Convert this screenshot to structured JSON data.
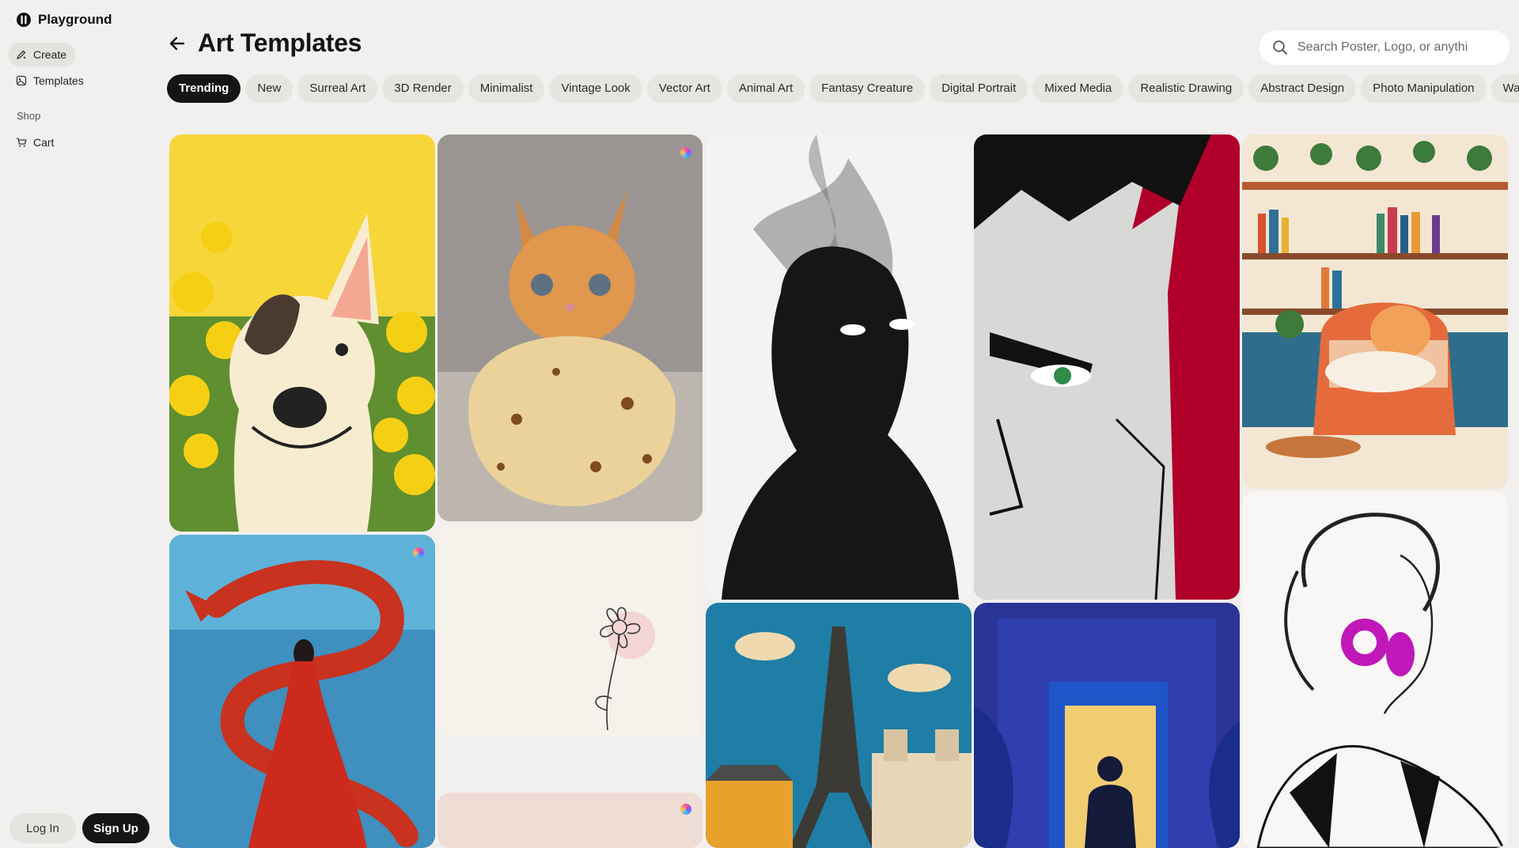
{
  "app": {
    "name": "Playground"
  },
  "sidebar": {
    "items": [
      {
        "label": "Create",
        "icon": "pen-sparkle-icon"
      },
      {
        "label": "Templates",
        "icon": "templates-icon"
      }
    ],
    "shop_section": {
      "label": "Shop",
      "items": [
        {
          "label": "Cart",
          "icon": "cart-icon"
        }
      ]
    },
    "auth": {
      "login": "Log In",
      "signup": "Sign Up"
    }
  },
  "header": {
    "title": "Art Templates",
    "back_icon": "arrow-left-icon",
    "search": {
      "placeholder": "Search Poster, Logo, or anythi",
      "icon": "search-icon"
    }
  },
  "tabs": [
    {
      "label": "Trending",
      "active": true
    },
    {
      "label": "New"
    },
    {
      "label": "Surreal Art"
    },
    {
      "label": "3D Render"
    },
    {
      "label": "Minimalist"
    },
    {
      "label": "Vintage Look"
    },
    {
      "label": "Vector Art"
    },
    {
      "label": "Animal Art"
    },
    {
      "label": "Fantasy Creature"
    },
    {
      "label": "Digital Portrait"
    },
    {
      "label": "Mixed Media"
    },
    {
      "label": "Realistic Drawing"
    },
    {
      "label": "Abstract Design"
    },
    {
      "label": "Photo Manipulation"
    },
    {
      "label": "Waterc"
    }
  ],
  "gallery": [
    {
      "subject": "cartoon dog with yellow flowers"
    },
    {
      "subject": "kitten wrapped in tortilla"
    },
    {
      "subject": "smoke silhouette with glowing eyes"
    },
    {
      "subject": "comic-style man portrait on red"
    },
    {
      "subject": "cat on armchair in cozy library"
    },
    {
      "subject": "red dragon and woman in water"
    },
    {
      "subject": "minimal line-art flower"
    },
    {
      "subject": "eiffel tower paper craft"
    },
    {
      "subject": "figure in doorway blue illustration"
    },
    {
      "subject": "ink sketch woman with magenta earring"
    },
    {
      "subject": "pale pastel artwork"
    }
  ],
  "colors": {
    "background": "#f1f0ee",
    "active_tab": "#151515",
    "tab": "#e6e5e2"
  }
}
